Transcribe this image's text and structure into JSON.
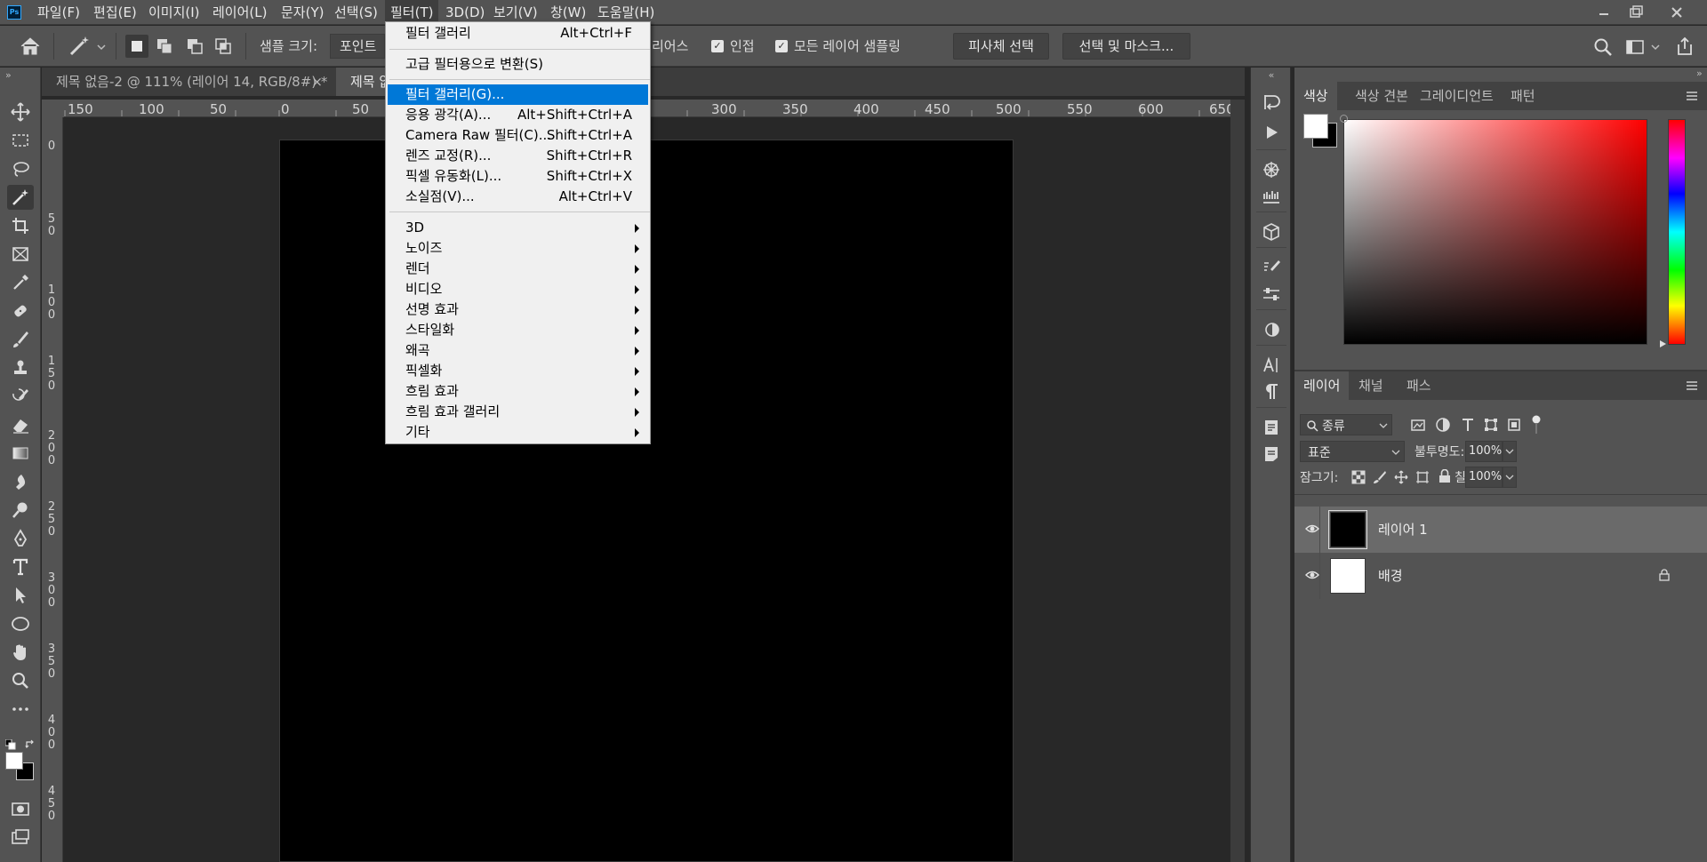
{
  "app": {
    "logo": "Ps"
  },
  "menubar": {
    "items": [
      "파일(F)",
      "편집(E)",
      "이미지(I)",
      "레이어(L)",
      "문자(Y)",
      "선택(S)",
      "필터(T)",
      "3D(D)",
      "보기(V)",
      "창(W)",
      "도움말(H)"
    ],
    "active": "필터(T)"
  },
  "options": {
    "sample_size_label": "샘플 크기:",
    "sample_size_value": "포인트",
    "antialias_label": "리어스",
    "contiguous_label": "인접",
    "sample_all_label": "모든 레이어 샘플링",
    "select_subject": "피사체 선택",
    "select_mask": "선택 및 마스크..."
  },
  "tabs": [
    {
      "label": "제목 없음-2 @ 111% (레이어 14, RGB/8#) *",
      "close": "×"
    },
    {
      "label": "제목 없"
    }
  ],
  "ruler": {
    "h": [
      "150",
      "100",
      "50",
      "0",
      "50",
      "600",
      "650"
    ],
    "h_right": [
      "300",
      "350",
      "400",
      "450",
      "500",
      "550",
      "600",
      "650"
    ],
    "v": [
      "0",
      "50",
      "100",
      "150",
      "200",
      "250",
      "300",
      "350",
      "400",
      "450"
    ]
  },
  "filter_menu": {
    "items": [
      {
        "label": "필터 갤러리",
        "shortcut": "Alt+Ctrl+F"
      },
      {
        "sep": true
      },
      {
        "label": "고급 필터용으로 변환(S)",
        "shortcut": ""
      },
      {
        "sep": true
      },
      {
        "label": "필터 갤러리(G)...",
        "shortcut": "",
        "highlight": true
      },
      {
        "label": "응용 광각(A)...",
        "shortcut": "Alt+Shift+Ctrl+A"
      },
      {
        "label": "Camera Raw 필터(C)...",
        "shortcut": "Shift+Ctrl+A"
      },
      {
        "label": "렌즈 교정(R)...",
        "shortcut": "Shift+Ctrl+R"
      },
      {
        "label": "픽셀 유동화(L)...",
        "shortcut": "Shift+Ctrl+X"
      },
      {
        "label": "소실점(V)...",
        "shortcut": "Alt+Ctrl+V"
      },
      {
        "sep": true
      },
      {
        "label": "3D",
        "submenu": true
      },
      {
        "label": "노이즈",
        "submenu": true
      },
      {
        "label": "렌더",
        "submenu": true
      },
      {
        "label": "비디오",
        "submenu": true
      },
      {
        "label": "선명 효과",
        "submenu": true
      },
      {
        "label": "스타일화",
        "submenu": true
      },
      {
        "label": "왜곡",
        "submenu": true
      },
      {
        "label": "픽셀화",
        "submenu": true
      },
      {
        "label": "흐림 효과",
        "submenu": true
      },
      {
        "label": "흐림 효과 갤러리",
        "submenu": true
      },
      {
        "label": "기타",
        "submenu": true
      }
    ]
  },
  "color_panel": {
    "tabs": [
      "색상",
      "색상 견본",
      "그레이디언트",
      "패턴"
    ],
    "active": "색상"
  },
  "layers_panel": {
    "tabs": [
      "레이어",
      "채널",
      "패스"
    ],
    "active": "레이어",
    "filter_kind": "종류",
    "blend_mode": "표준",
    "opacity_label": "불투명도:",
    "opacity_value": "100%",
    "lock_label": "잠그기:",
    "fill_label": "칠:",
    "fill_value": "100%",
    "layers": [
      {
        "name": "레이어 1",
        "thumb": "#000000",
        "selected": true,
        "locked": false
      },
      {
        "name": "배경",
        "thumb": "#ffffff",
        "selected": false,
        "locked": true
      }
    ]
  },
  "colors": {
    "accent": "#0078d7",
    "panel": "#535353",
    "bg": "#282828",
    "hue_top": "#ff0000"
  }
}
